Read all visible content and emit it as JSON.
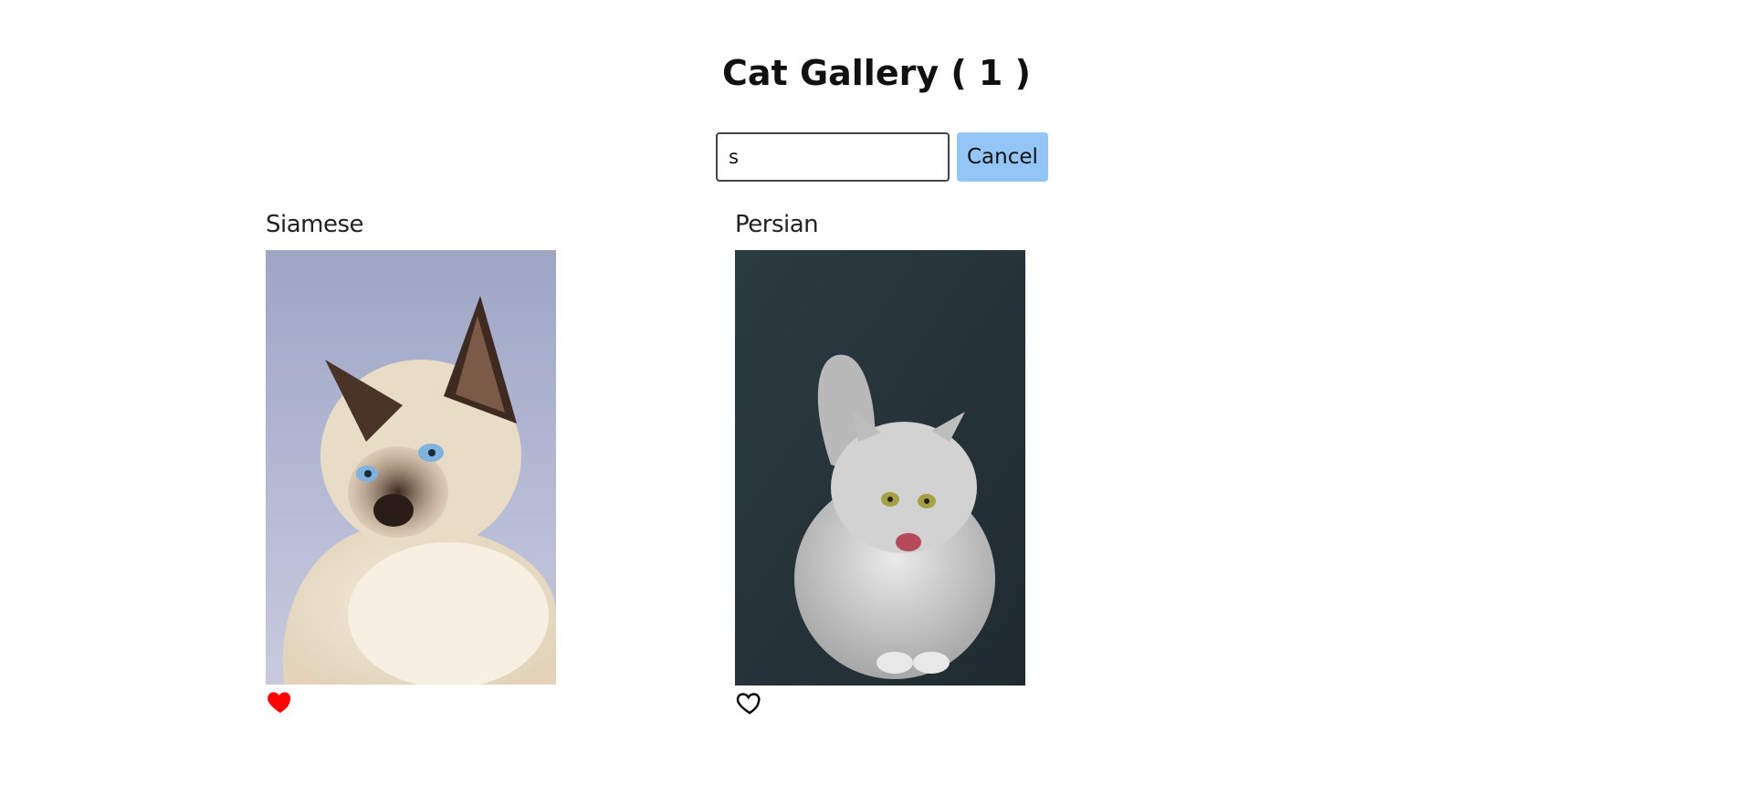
{
  "header": {
    "title": "Cat Gallery ( 1 )"
  },
  "search": {
    "value": "s",
    "cancel_label": "Cancel"
  },
  "colors": {
    "cancel_bg": "#93c5f7",
    "liked_heart": "#ff0000",
    "unliked_heart": "#000000"
  },
  "cats": [
    {
      "name": "Siamese",
      "liked": true,
      "like_icon": "heart-filled-icon"
    },
    {
      "name": "Persian",
      "liked": false,
      "like_icon": "heart-outline-icon"
    }
  ]
}
